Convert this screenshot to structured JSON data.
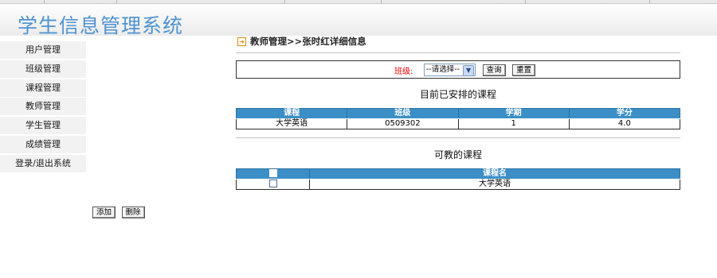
{
  "app": {
    "title": "学生信息管理系统"
  },
  "sidebar": {
    "items": [
      {
        "label": "用户管理"
      },
      {
        "label": "班级管理"
      },
      {
        "label": "课程管理"
      },
      {
        "label": "教师管理"
      },
      {
        "label": "学生管理"
      },
      {
        "label": "成绩管理"
      },
      {
        "label": "登录/退出系统"
      }
    ]
  },
  "breadcrumb": {
    "icon": "arrow-right-icon",
    "text": "教师管理>>张时红详细信息"
  },
  "filter": {
    "label": "班级:",
    "select_value": "--请选择--",
    "query_label": "查询",
    "reset_label": "重置"
  },
  "scheduled": {
    "title": "目前已安排的课程",
    "columns": [
      "课程",
      "班级",
      "学期",
      "学分"
    ],
    "rows": [
      [
        "大学英语",
        "0509302",
        "1",
        "4.0"
      ]
    ]
  },
  "teachable": {
    "title": "可教的课程",
    "columns": [
      "",
      "课程名"
    ],
    "rows": [
      [
        "",
        "大学英语"
      ]
    ]
  },
  "actions": {
    "add_label": "添加",
    "delete_label": "删除"
  },
  "colors": {
    "title_blue": "#4f93cf",
    "header_blue": "#3c8fc6",
    "label_red": "#ff0000",
    "crumb_orange": "#e08b12"
  }
}
